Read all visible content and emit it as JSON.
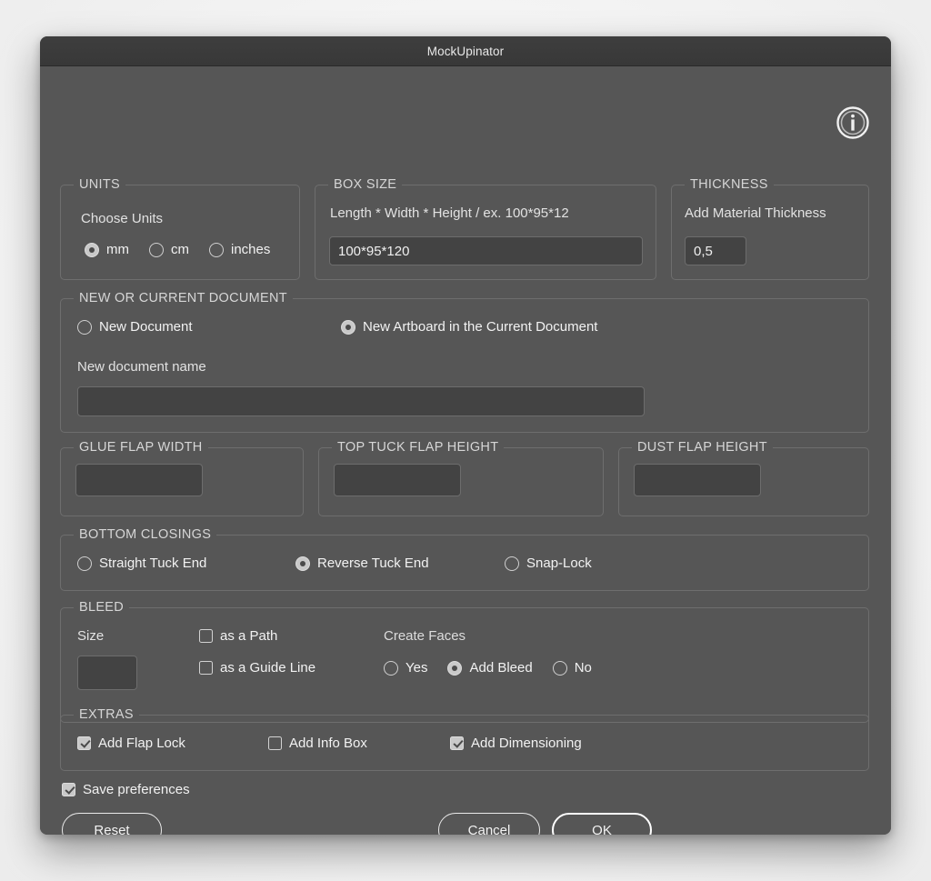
{
  "window": {
    "title": "MockUpinator",
    "info_icon": "info-icon"
  },
  "units": {
    "legend": "UNITS",
    "sublabel": "Choose Units",
    "options": [
      {
        "label": "mm",
        "selected": true
      },
      {
        "label": "cm",
        "selected": false
      },
      {
        "label": "inches",
        "selected": false
      }
    ]
  },
  "box_size": {
    "legend": "BOX SIZE",
    "sublabel": "Length * Width * Height  / ex. 100*95*12",
    "value": "100*95*120",
    "placeholder": ""
  },
  "thickness": {
    "legend": "THICKNESS",
    "sublabel": "Add Material Thickness",
    "value": "0,5",
    "placeholder": ""
  },
  "document": {
    "legend": "NEW OR CURRENT DOCUMENT",
    "options": [
      {
        "label": "New Document",
        "selected": false
      },
      {
        "label": "New Artboard in the Current Document",
        "selected": true
      }
    ],
    "name_label": "New document name",
    "name_value": "",
    "name_placeholder": ""
  },
  "glue_flap": {
    "legend": "GLUE FLAP WIDTH",
    "value": "",
    "placeholder": ""
  },
  "top_tuck_flap": {
    "legend": "TOP TUCK FLAP HEIGHT",
    "value": "",
    "placeholder": ""
  },
  "dust_flap": {
    "legend": "DUST FLAP HEIGHT",
    "value": "",
    "placeholder": ""
  },
  "bottom_closings": {
    "legend": "BOTTOM CLOSINGS",
    "options": [
      {
        "label": "Straight Tuck End",
        "selected": false
      },
      {
        "label": "Reverse Tuck End",
        "selected": true
      },
      {
        "label": "Snap-Lock",
        "selected": false
      }
    ]
  },
  "bleed": {
    "legend": "BLEED",
    "size_label": "Size",
    "size_value": "",
    "size_placeholder": "",
    "checkboxes": [
      {
        "label": "as a Path",
        "checked": false
      },
      {
        "label": "as a Guide Line",
        "checked": false
      }
    ],
    "create_faces_label": "Create Faces",
    "create_faces_options": [
      {
        "label": "Yes",
        "selected": false
      },
      {
        "label": "Add Bleed",
        "selected": true
      },
      {
        "label": "No",
        "selected": false
      }
    ]
  },
  "extras": {
    "legend": "EXTRAS",
    "checkboxes": [
      {
        "label": "Add Flap Lock",
        "checked": true
      },
      {
        "label": "Add Info Box",
        "checked": false
      },
      {
        "label": "Add Dimensioning",
        "checked": true
      }
    ]
  },
  "save_preferences": {
    "label": "Save preferences",
    "checked": true
  },
  "buttons": {
    "reset": "Reset",
    "cancel": "Cancel",
    "ok": "OK"
  },
  "colors": {
    "window_bg": "#565656",
    "titlebar_bg": "#3b3b3b",
    "field_bg": "#434343",
    "border": "#6e6e6e",
    "text": "#f2f2f2",
    "muted_text": "#d6d6d6"
  }
}
